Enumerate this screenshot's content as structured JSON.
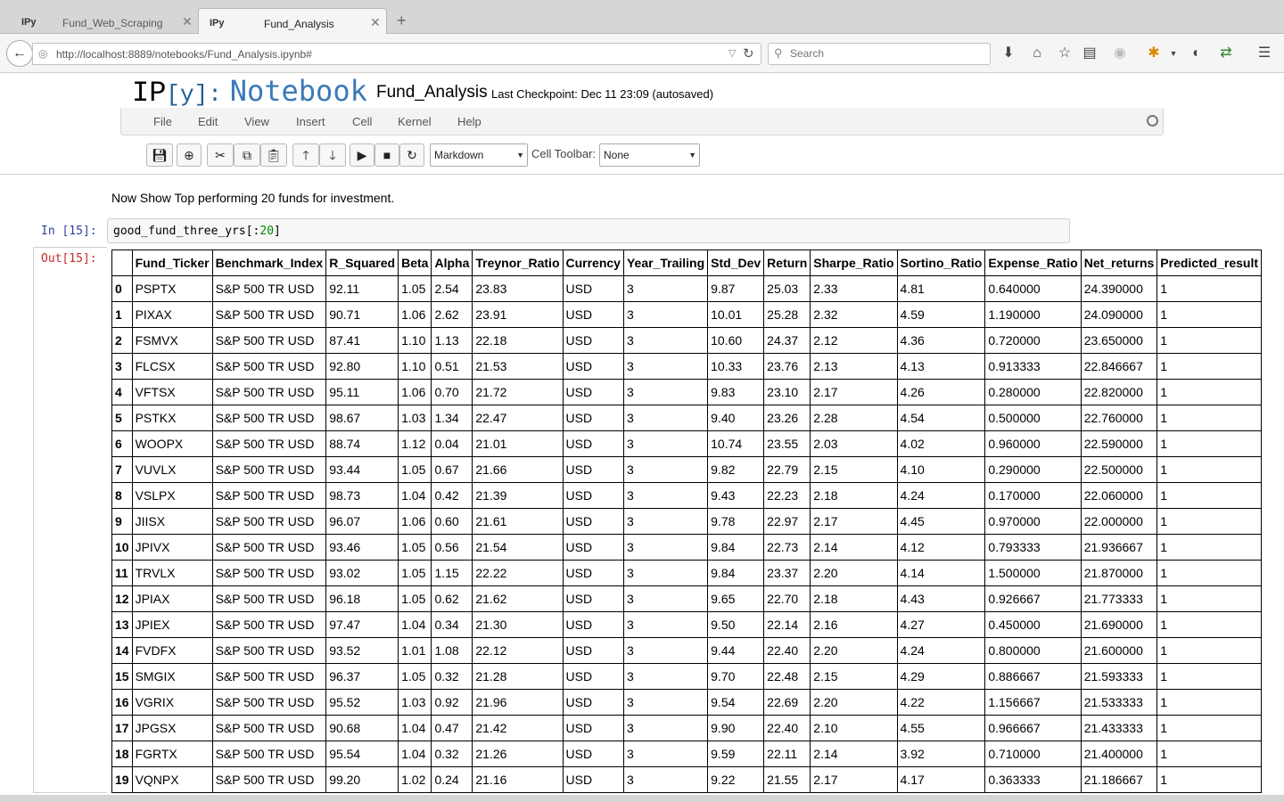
{
  "tabs": [
    {
      "icon": "IPy",
      "title": "Fund_Web_Scraping",
      "close": "✕"
    },
    {
      "icon": "IPy",
      "title": "Fund_Analysis",
      "close": "✕"
    }
  ],
  "new_tab": "+",
  "nav": {
    "back": "←",
    "url": "http://localhost:8889/notebooks/Fund_Analysis.ipynb#",
    "search_placeholder": "Search"
  },
  "header": {
    "logo_ip": "IP",
    "logo_y": "[y]:",
    "logo_notebook": "Notebook",
    "notebook_name": "Fund_Analysis",
    "checkpoint": "Last Checkpoint: Dec 11 23:09 (autosaved)"
  },
  "menu": [
    "File",
    "Edit",
    "View",
    "Insert",
    "Cell",
    "Kernel",
    "Help"
  ],
  "toolbar": {
    "cell_type": "Markdown",
    "cell_toolbar_label": "Cell Toolbar:",
    "cell_toolbar_value": "None"
  },
  "notebook": {
    "markdown_text": "Now Show Top performing 20 funds for investment.",
    "in_prompt": "In [15]:",
    "code_text": "good_fund_three_yrs[:",
    "code_num": "20",
    "code_end": "]",
    "out_prompt": "Out[15]:"
  },
  "table": {
    "columns": [
      "",
      "Fund_Ticker",
      "Benchmark_Index",
      "R_Squared",
      "Beta",
      "Alpha",
      "Treynor_Ratio",
      "Currency",
      "Year_Trailing",
      "Std_Dev",
      "Return",
      "Sharpe_Ratio",
      "Sortino_Ratio",
      "Expense_Ratio",
      "Net_returns",
      "Predicted_result"
    ],
    "rows": [
      [
        "0",
        "PSPTX",
        "S&P 500 TR USD",
        "92.11",
        "1.05",
        "2.54",
        "23.83",
        "USD",
        "3",
        "9.87",
        "25.03",
        "2.33",
        "4.81",
        "0.640000",
        "24.390000",
        "1"
      ],
      [
        "1",
        "PIXAX",
        "S&P 500 TR USD",
        "90.71",
        "1.06",
        "2.62",
        "23.91",
        "USD",
        "3",
        "10.01",
        "25.28",
        "2.32",
        "4.59",
        "1.190000",
        "24.090000",
        "1"
      ],
      [
        "2",
        "FSMVX",
        "S&P 500 TR USD",
        "87.41",
        "1.10",
        "1.13",
        "22.18",
        "USD",
        "3",
        "10.60",
        "24.37",
        "2.12",
        "4.36",
        "0.720000",
        "23.650000",
        "1"
      ],
      [
        "3",
        "FLCSX",
        "S&P 500 TR USD",
        "92.80",
        "1.10",
        "0.51",
        "21.53",
        "USD",
        "3",
        "10.33",
        "23.76",
        "2.13",
        "4.13",
        "0.913333",
        "22.846667",
        "1"
      ],
      [
        "4",
        "VFTSX",
        "S&P 500 TR USD",
        "95.11",
        "1.06",
        "0.70",
        "21.72",
        "USD",
        "3",
        "9.83",
        "23.10",
        "2.17",
        "4.26",
        "0.280000",
        "22.820000",
        "1"
      ],
      [
        "5",
        "PSTKX",
        "S&P 500 TR USD",
        "98.67",
        "1.03",
        "1.34",
        "22.47",
        "USD",
        "3",
        "9.40",
        "23.26",
        "2.28",
        "4.54",
        "0.500000",
        "22.760000",
        "1"
      ],
      [
        "6",
        "WOOPX",
        "S&P 500 TR USD",
        "88.74",
        "1.12",
        "0.04",
        "21.01",
        "USD",
        "3",
        "10.74",
        "23.55",
        "2.03",
        "4.02",
        "0.960000",
        "22.590000",
        "1"
      ],
      [
        "7",
        "VUVLX",
        "S&P 500 TR USD",
        "93.44",
        "1.05",
        "0.67",
        "21.66",
        "USD",
        "3",
        "9.82",
        "22.79",
        "2.15",
        "4.10",
        "0.290000",
        "22.500000",
        "1"
      ],
      [
        "8",
        "VSLPX",
        "S&P 500 TR USD",
        "98.73",
        "1.04",
        "0.42",
        "21.39",
        "USD",
        "3",
        "9.43",
        "22.23",
        "2.18",
        "4.24",
        "0.170000",
        "22.060000",
        "1"
      ],
      [
        "9",
        "JIISX",
        "S&P 500 TR USD",
        "96.07",
        "1.06",
        "0.60",
        "21.61",
        "USD",
        "3",
        "9.78",
        "22.97",
        "2.17",
        "4.45",
        "0.970000",
        "22.000000",
        "1"
      ],
      [
        "10",
        "JPIVX",
        "S&P 500 TR USD",
        "93.46",
        "1.05",
        "0.56",
        "21.54",
        "USD",
        "3",
        "9.84",
        "22.73",
        "2.14",
        "4.12",
        "0.793333",
        "21.936667",
        "1"
      ],
      [
        "11",
        "TRVLX",
        "S&P 500 TR USD",
        "93.02",
        "1.05",
        "1.15",
        "22.22",
        "USD",
        "3",
        "9.84",
        "23.37",
        "2.20",
        "4.14",
        "1.500000",
        "21.870000",
        "1"
      ],
      [
        "12",
        "JPIAX",
        "S&P 500 TR USD",
        "96.18",
        "1.05",
        "0.62",
        "21.62",
        "USD",
        "3",
        "9.65",
        "22.70",
        "2.18",
        "4.43",
        "0.926667",
        "21.773333",
        "1"
      ],
      [
        "13",
        "JPIEX",
        "S&P 500 TR USD",
        "97.47",
        "1.04",
        "0.34",
        "21.30",
        "USD",
        "3",
        "9.50",
        "22.14",
        "2.16",
        "4.27",
        "0.450000",
        "21.690000",
        "1"
      ],
      [
        "14",
        "FVDFX",
        "S&P 500 TR USD",
        "93.52",
        "1.01",
        "1.08",
        "22.12",
        "USD",
        "3",
        "9.44",
        "22.40",
        "2.20",
        "4.24",
        "0.800000",
        "21.600000",
        "1"
      ],
      [
        "15",
        "SMGIX",
        "S&P 500 TR USD",
        "96.37",
        "1.05",
        "0.32",
        "21.28",
        "USD",
        "3",
        "9.70",
        "22.48",
        "2.15",
        "4.29",
        "0.886667",
        "21.593333",
        "1"
      ],
      [
        "16",
        "VGRIX",
        "S&P 500 TR USD",
        "95.52",
        "1.03",
        "0.92",
        "21.96",
        "USD",
        "3",
        "9.54",
        "22.69",
        "2.20",
        "4.22",
        "1.156667",
        "21.533333",
        "1"
      ],
      [
        "17",
        "JPGSX",
        "S&P 500 TR USD",
        "90.68",
        "1.04",
        "0.47",
        "21.42",
        "USD",
        "3",
        "9.90",
        "22.40",
        "2.10",
        "4.55",
        "0.966667",
        "21.433333",
        "1"
      ],
      [
        "18",
        "FGRTX",
        "S&P 500 TR USD",
        "95.54",
        "1.04",
        "0.32",
        "21.26",
        "USD",
        "3",
        "9.59",
        "22.11",
        "2.14",
        "3.92",
        "0.710000",
        "21.400000",
        "1"
      ],
      [
        "19",
        "VQNPX",
        "S&P 500 TR USD",
        "99.20",
        "1.02",
        "0.24",
        "21.16",
        "USD",
        "3",
        "9.22",
        "21.55",
        "2.17",
        "4.17",
        "0.363333",
        "21.186667",
        "1"
      ]
    ]
  }
}
